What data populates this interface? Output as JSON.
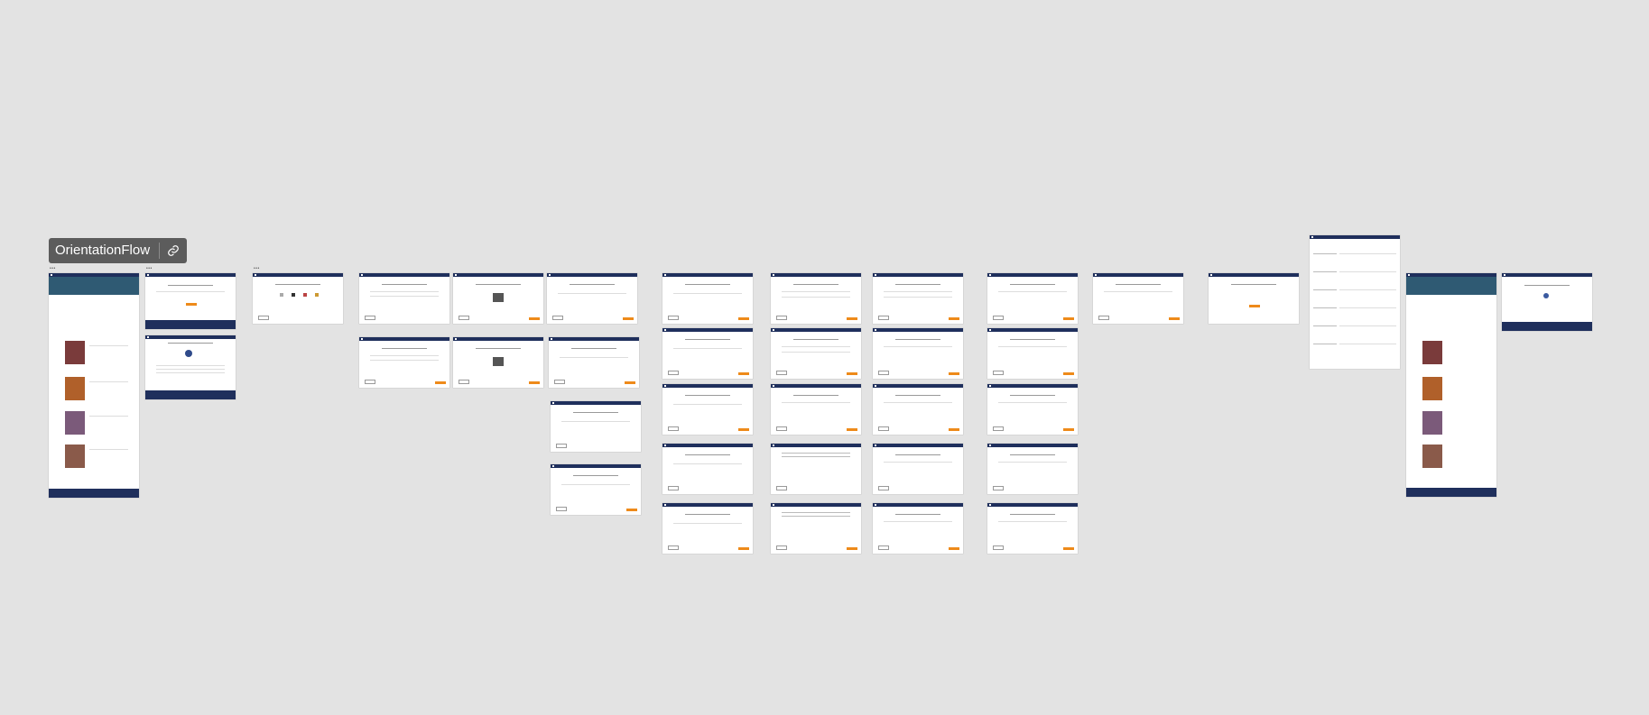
{
  "flow": {
    "name": "OrientationFlow",
    "link_icon": "link-icon"
  },
  "caption": "",
  "colors": {
    "canvas": "#e3e3e3",
    "header": "#1f2f5c",
    "accent": "#ee8a1a",
    "label_bg": "#5c5c5c"
  },
  "frame_count": 39
}
